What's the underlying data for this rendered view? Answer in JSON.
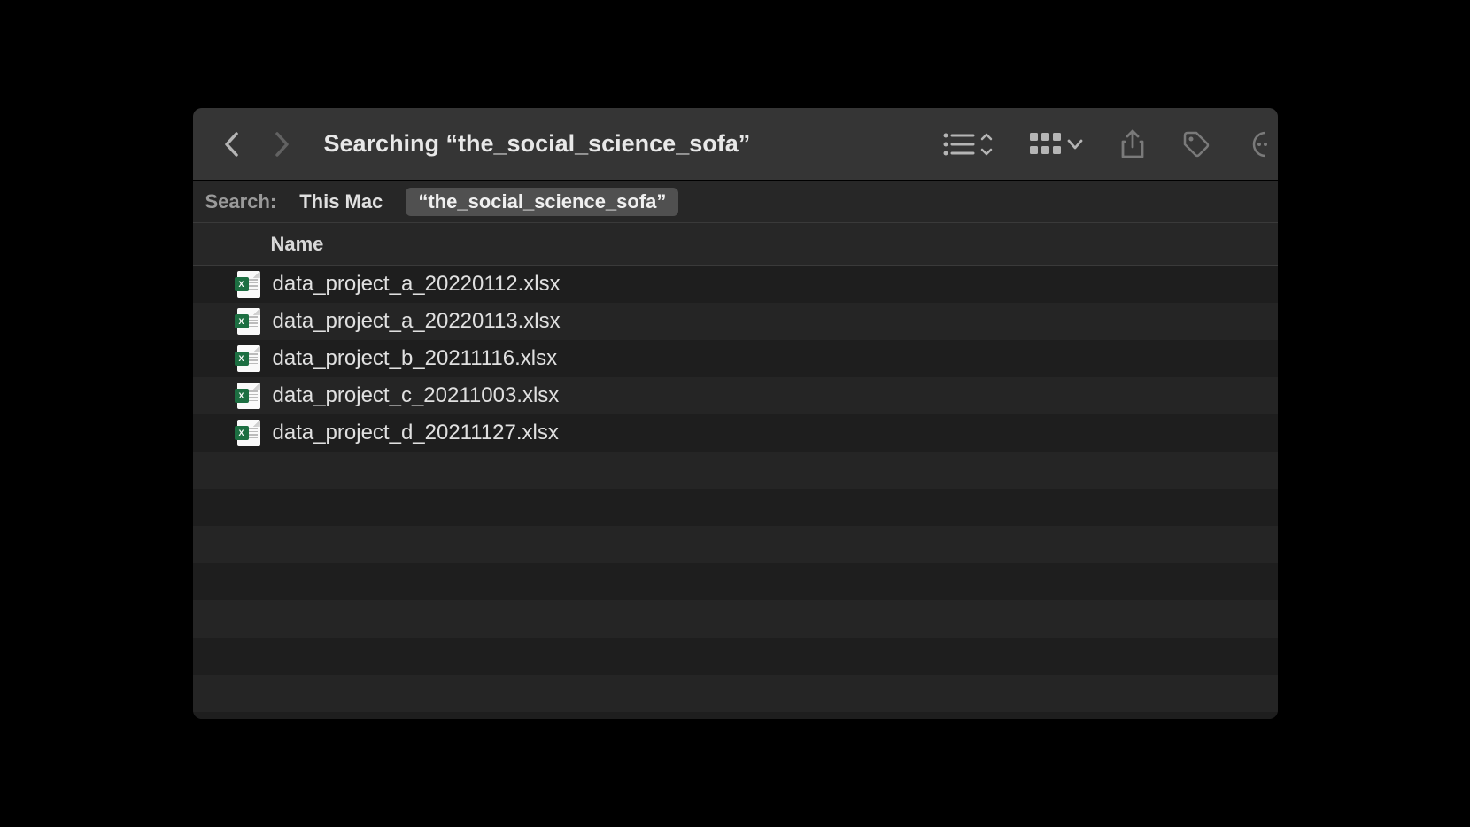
{
  "toolbar": {
    "title": "Searching “the_social_science_sofa”"
  },
  "scope": {
    "label": "Search:",
    "items": [
      {
        "label": "This Mac",
        "active": false
      },
      {
        "label": "“the_social_science_sofa”",
        "active": true
      }
    ]
  },
  "columns": {
    "name_header": "Name"
  },
  "files": [
    {
      "name": "data_project_a_20220112.xlsx"
    },
    {
      "name": "data_project_a_20220113.xlsx"
    },
    {
      "name": "data_project_b_20211116.xlsx"
    },
    {
      "name": "data_project_c_20211003.xlsx"
    },
    {
      "name": "data_project_d_20211127.xlsx"
    }
  ]
}
